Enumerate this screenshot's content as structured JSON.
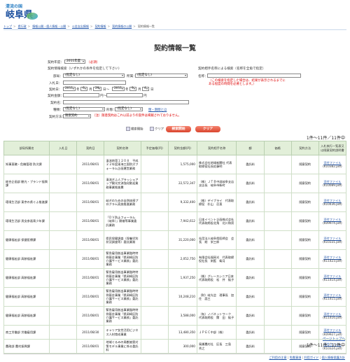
{
  "header": {
    "logo_top": "清流の国",
    "logo_main": "岐阜県"
  },
  "breadcrumb": [
    "トップ",
    "県行政",
    "情報公開・個人情報・公開",
    "公金支出情報",
    "契約情報",
    "契約情報の公開",
    "契約情報一覧"
  ],
  "page_title": "契約情報一覧",
  "form": {
    "year_label": "契約年度：",
    "year_value": "2011年度",
    "year_required": "（必須）",
    "search_heading": "契約情報検索（いずれかの条件を指定して下さい）",
    "bureau_label": "部局：",
    "bureau_value": "(指定なし)",
    "section_label": "所属：",
    "section_value": "(指定なし)",
    "entry_label": "入札日：",
    "entry_value": "",
    "date_label": "契約日：",
    "date_from_year": "2011",
    "date_from_month": "6",
    "date_from_day": "29",
    "date_to_year": "2011",
    "date_to_month": "9",
    "date_to_day": "4",
    "amount_label": "契約金額：",
    "amount_to": "円～",
    "amount_unit": "円",
    "name_label": "契約名：",
    "kind_label": "種類：",
    "kind_value": "(指定なし)",
    "method_label": "形態：",
    "method_value": "(指定なし)",
    "clear_link": "閉・期間とほ",
    "method2_label": "契約方法：",
    "method2_value": "随意契約",
    "method2_note": "（注）随意契約はこれ以前よりの案件は掲載されておりません。",
    "partner_heading": "契約相手名称による検索（名称を全角で指定）",
    "partner_label": "名称：",
    "partner_note": "（この検索を指定した場合は、結果が表示されるまでに\nある程度の時間を必要とします。）",
    "btn_print": "検索開始",
    "btn_clear_icon": "クリア",
    "btn_search": "検索開始",
    "btn_clear": "クリア"
  },
  "result_count": "1件～11件／11件中",
  "table": {
    "headers": [
      "部局所属名",
      "入札日",
      "契約日",
      "契約名称",
      "予定価格(円)",
      "契約金額(円)",
      "契約相手名称",
      "額",
      "価格",
      "契約方法",
      "入札執行一覧表又は随意契約説明書"
    ],
    "rows": [
      [
        "知事直轄・危機管理 防災課",
        "",
        "2011/08/01",
        "清流地帯１２０８　平成２２年度東海三国防災フォーラム企画運営業務",
        "",
        "1,575,000",
        "株式会社地域新聞社 代表取締役社長佐藤明",
        "委託料",
        "",
        "随意契約",
        "添付ファイル",
        "(K10382.pdf)"
      ],
      [
        "総合企画部 観光・ブランド振興課",
        "",
        "2011/08/01",
        "清流ぎふ人プラッシュアップ観光交流強化歓迎業務事業推進費",
        "",
        "22,572,347",
        "（株）ＪＴＢ中部岐阜支店　支店長　岐阜市新町",
        "委託料",
        "",
        "随意契約",
        "添付ファイル",
        "(K10089.pdf)"
      ],
      [
        "環境生活部 東京の県ぐふ推進課",
        "",
        "2011/08/01",
        "岐ぎのための自然体感プログラム実施推進業務",
        "",
        "9,332,400",
        "（株）デイブライ　代表取締役　杉山　忍直",
        "委託料",
        "",
        "随意契約",
        "添付ファイル",
        "(K10436.pdf)"
      ],
      [
        "環境生活部 男女参画青少年課",
        "",
        "2011/08/01",
        "「ＤＶ防止フォーラム（岐阜）」開催等事業委託業務",
        "",
        "7,942,612",
        "日本イベント企画株式会社　代表取締役北角　北川和男",
        "委託料",
        "",
        "随意契約",
        "添付ファイル",
        "(K09974.pdf)"
      ],
      [
        "健康福祉部 保健医療課",
        "",
        "2011/08/01",
        "県民保健調査（保養児別状況調査等）委託業務",
        "",
        "31,220,000",
        "社団法人岐阜県医師会　会長　総　栄三郎",
        "委託料",
        "",
        "随意契約",
        "添付ファイル",
        "(K10331.pdf)"
      ],
      [
        "健康福祉部 高齢福祉課",
        "",
        "2011/08/01",
        "緊急雇用創出事業臨時特例基金事業「県岡崎区防介護サービス業務」委託業務",
        "",
        "2,052,750",
        "有限会社福岡光　代表取締役社長　剣藍　衛月",
        "委託料",
        "",
        "随意契約",
        "添付ファイル",
        "(K11423.pdf)"
      ],
      [
        "健康福祉部 高齢福祉課",
        "",
        "2011/08/01",
        "緊急雇用創出事業臨時特例基金事業「県岡崎区防介護サービス業務」委託業務",
        "",
        "1,937,250",
        "（株）グレースシニア日本　代表取締役　松　井　紘子",
        "委託料",
        "",
        "随意契約",
        "添付ファイル",
        "(K11414.pdf)"
      ],
      [
        "健康福祉部 高齢福祉課",
        "",
        "2011/08/01",
        "緊急雇用創出事業臨時特例基金事業「県岡崎区防介護サービス業務」委託業務",
        "",
        "10,248,210",
        "（財）岐光会　理事長　加住　語三",
        "委託料",
        "",
        "随意契約",
        "添付ファイル",
        "(K11415.pdf)"
      ],
      [
        "健康福祉部 高齢福祉課",
        "",
        "2011/08/01",
        "緊急雇用創出事業臨時特例基金事業「県岡崎区防介護サービス業務」委託業務",
        "",
        "3,588,000",
        "（有）ノバネットワーク　代表取締役　関　田　紘子",
        "委託料",
        "",
        "随意契約",
        "添付ファイル",
        "(K11416.pdf)"
      ],
      [
        "商工労働部 労働雇用課",
        "",
        "2011/08/30",
        "キャリア女性活用ビジネス人材育成事業",
        "",
        "13,480,350",
        "ＪＰＥＣ中部（株）",
        "委託料",
        "",
        "随意契約",
        "添付ファイル",
        "(K09927.pdf)"
      ],
      [
        "農政部 農村振興課",
        "",
        "2011/08/01",
        "地域ぐるみの鳥獣被害対策モデル事業に係る委託料",
        "",
        "300,000",
        "鳥瀬農村社　区長　三島　秀之",
        "委託料",
        "",
        "随意契約",
        "添付ファイル",
        "(K10324.pdf)"
      ]
    ]
  },
  "page_top": "ページトップへ",
  "result_count_bottom": "1件～11件／11件中",
  "footer": {
    "links": [
      "ご利用の注意",
      "免責事項",
      "利用ガイド",
      "個人情報保護方針"
    ]
  },
  "colors": {
    "header_blue": "#1a4f9e",
    "table_header_bg": "#e2efd9",
    "button_red": "#d9452e",
    "link_blue": "#2255aa",
    "note_red": "#dd0000"
  }
}
